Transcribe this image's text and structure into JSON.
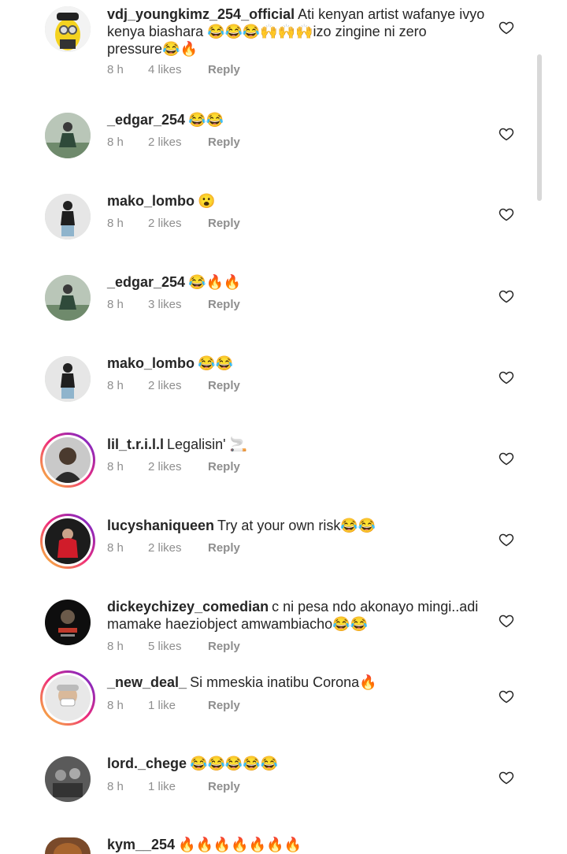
{
  "comments": [
    {
      "username": "vdj_youngkimz_254_official",
      "text": "Ati kenyan artist wafanye ivyo kenya biashara 😂😂😂🙌🙌🙌izo zingine ni zero pressure😂🔥",
      "time": "8 h",
      "likes": "4 likes",
      "reply": "Reply"
    },
    {
      "username": "_edgar_254",
      "text": "😂😂",
      "time": "8 h",
      "likes": "2 likes",
      "reply": "Reply"
    },
    {
      "username": "mako_lombo",
      "text": "😮",
      "time": "8 h",
      "likes": "2 likes",
      "reply": "Reply"
    },
    {
      "username": "_edgar_254",
      "text": "😂🔥🔥",
      "time": "8 h",
      "likes": "3 likes",
      "reply": "Reply"
    },
    {
      "username": "mako_lombo",
      "text": "😂😂",
      "time": "8 h",
      "likes": "2 likes",
      "reply": "Reply"
    },
    {
      "username": "lil_t.r.i.l.l",
      "text": "Legalisin' 🚬",
      "time": "8 h",
      "likes": "2 likes",
      "reply": "Reply"
    },
    {
      "username": "lucyshaniqueen",
      "text": "Try at your own risk😂😂",
      "time": "8 h",
      "likes": "2 likes",
      "reply": "Reply"
    },
    {
      "username": "dickeychizey_comedian",
      "text": "c ni pesa ndo akonayo mingi..adi mamake haeziobject amwambiacho😂😂",
      "time": "8 h",
      "likes": "5 likes",
      "reply": "Reply"
    },
    {
      "username": "_new_deal_",
      "text": "Si mmeskia inatibu Corona🔥",
      "time": "8 h",
      "likes": "1 like",
      "reply": "Reply"
    },
    {
      "username": "lord._chege",
      "text": "😂😂😂😂😂",
      "time": "8 h",
      "likes": "1 like",
      "reply": "Reply"
    },
    {
      "username": "kym__254",
      "text": "🔥🔥🔥🔥🔥🔥🔥",
      "time": "",
      "likes": "",
      "reply": ""
    }
  ],
  "icons": {
    "heart": "heart-outline-icon",
    "avatar": "avatar"
  },
  "colors": {
    "text": "#262626",
    "meta": "#8e8e8e",
    "story_ring_start": "#f9ce34",
    "story_ring_end": "#6228d7"
  }
}
